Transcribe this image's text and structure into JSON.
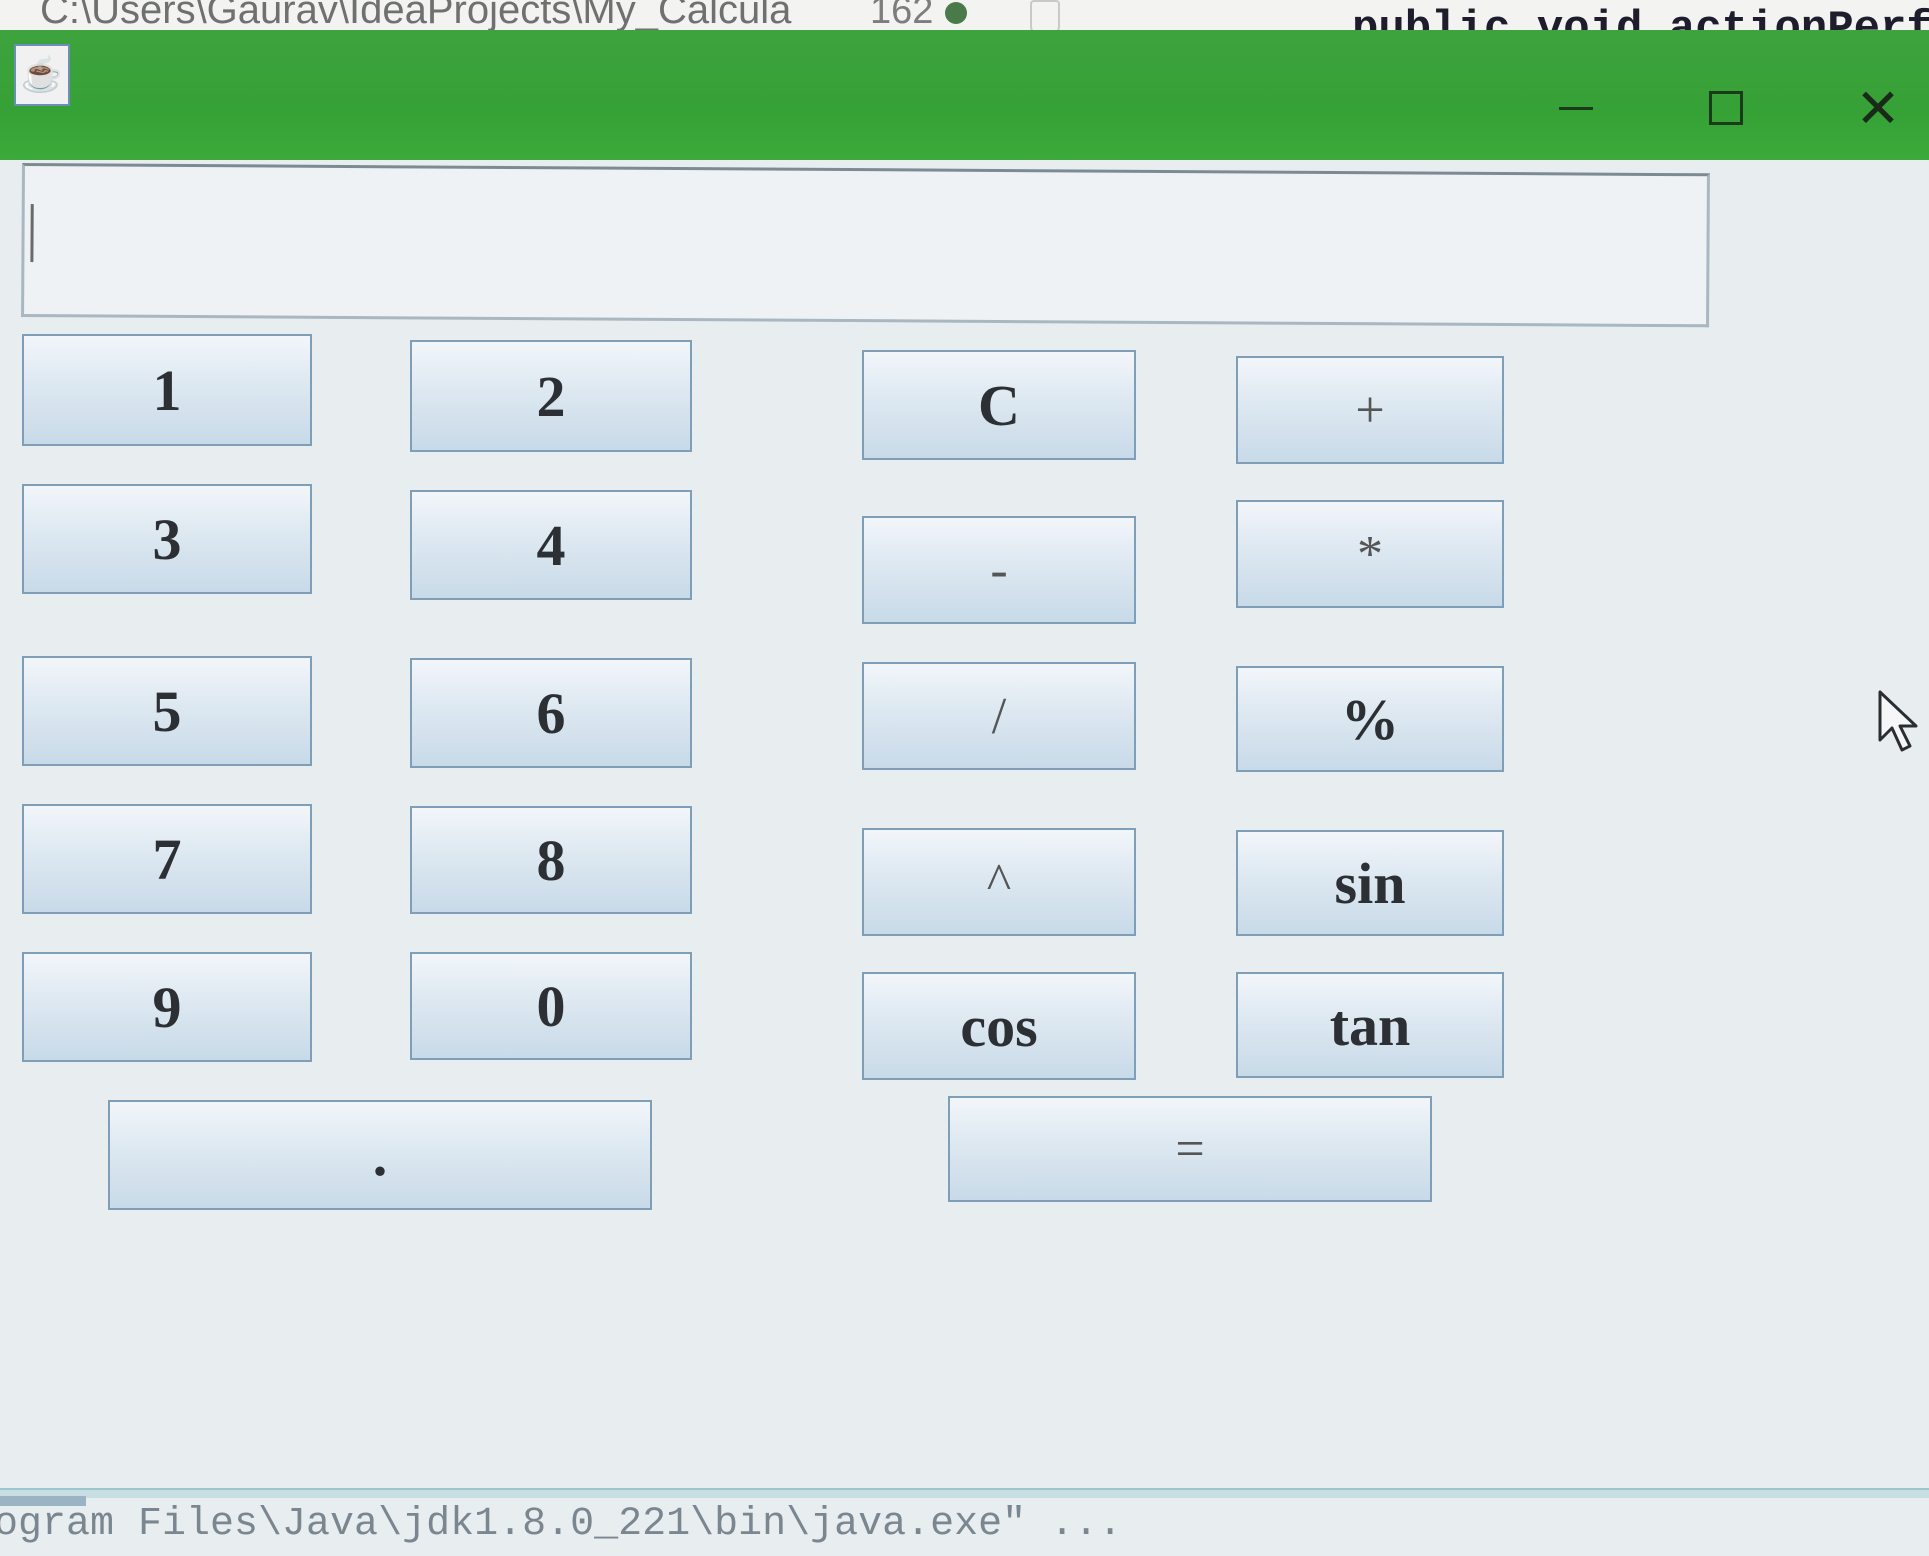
{
  "ide": {
    "path_text": "C:\\Users\\Gaurav\\IdeaProjects\\My_Calcula",
    "line_number": "162",
    "code_text": "public void actionPerform"
  },
  "window": {
    "icon": "java-coffee-icon",
    "minimize_glyph": "—",
    "maximize_glyph": "☐",
    "close_glyph": "✕"
  },
  "display": {
    "value": ""
  },
  "buttons": {
    "b1": "1",
    "b2": "2",
    "b3": "3",
    "b4": "4",
    "b5": "5",
    "b6": "6",
    "b7": "7",
    "b8": "8",
    "b9": "9",
    "b0": "0",
    "clear": "C",
    "plus": "+",
    "minus": "-",
    "multiply": "*",
    "divide": "/",
    "percent": "%",
    "power": "^",
    "sin": "sin",
    "cos": "cos",
    "tan": "tan",
    "dot": ".",
    "equals": "="
  },
  "console": {
    "text": "ogram Files\\Java\\jdk1.8.0_221\\bin\\java.exe\" ..."
  }
}
